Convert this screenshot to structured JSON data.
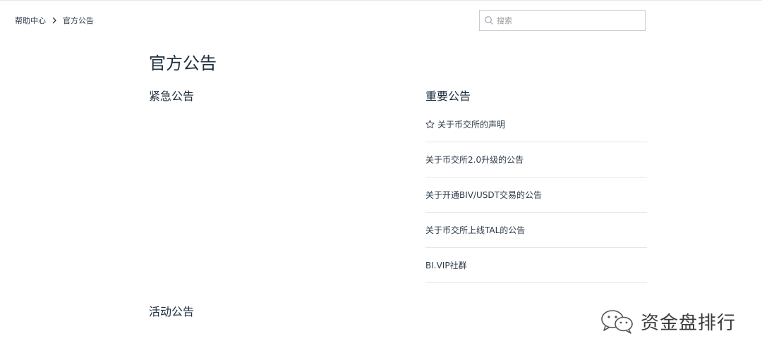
{
  "breadcrumb": {
    "home": "帮助中心",
    "current": "官方公告"
  },
  "search": {
    "placeholder": "搜索",
    "value": ""
  },
  "page_title": "官方公告",
  "sections": {
    "urgent": {
      "title": "紧急公告"
    },
    "important": {
      "title": "重要公告",
      "articles": [
        {
          "label": "关于币交所的声明",
          "starred": true
        },
        {
          "label": "关于币交所2.0升级的公告",
          "starred": false
        },
        {
          "label": "关于开通BIV/USDT交易的公告",
          "starred": false
        },
        {
          "label": "关于币交所上线TAL的公告",
          "starred": false
        },
        {
          "label": "BI.VIP社群",
          "starred": false
        }
      ]
    },
    "activity": {
      "title": "活动公告"
    }
  },
  "watermark": {
    "text": "资金盘排行",
    "icon": "wechat-icon"
  },
  "colors": {
    "text_primary": "#203040",
    "border": "#e3e6ea",
    "search_border": "#c8ccd1"
  }
}
